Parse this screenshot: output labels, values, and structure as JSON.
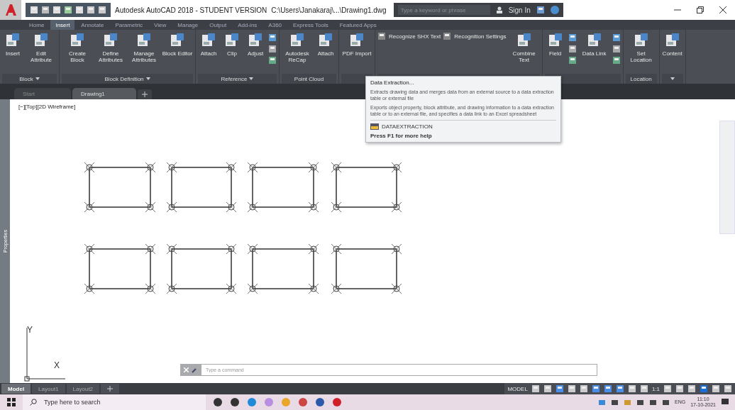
{
  "title_bar": {
    "app_title": "Autodesk AutoCAD 2018 - STUDENT VERSION",
    "file_path": "C:\\Users\\Janakaraj\\...\\Drawing1.dwg",
    "search_placeholder": "Type a keyword or phrase",
    "sign_in": "Sign In"
  },
  "ribbon_tabs": [
    {
      "label": "Home",
      "selected": false
    },
    {
      "label": "Insert",
      "selected": true
    },
    {
      "label": "Annotate",
      "selected": false
    },
    {
      "label": "Parametric",
      "selected": false
    },
    {
      "label": "View",
      "selected": false
    },
    {
      "label": "Manage",
      "selected": false
    },
    {
      "label": "Output",
      "selected": false
    },
    {
      "label": "Add-ins",
      "selected": false
    },
    {
      "label": "A360",
      "selected": false
    },
    {
      "label": "Express Tools",
      "selected": false
    },
    {
      "label": "Featured Apps",
      "selected": false
    }
  ],
  "panels": [
    {
      "title": "Block",
      "dropdown": true,
      "items": [
        {
          "kind": "large",
          "label": "Insert"
        },
        {
          "kind": "large",
          "label": "Edit Attribute"
        }
      ]
    },
    {
      "title": "Block Definition",
      "dropdown": true,
      "items": [
        {
          "kind": "large",
          "label": "Create Block"
        },
        {
          "kind": "large",
          "label": "Define Attributes"
        },
        {
          "kind": "large",
          "label": "Manage Attributes"
        },
        {
          "kind": "large",
          "label": "Block Editor"
        }
      ]
    },
    {
      "title": "Reference",
      "dropdown": true,
      "items": [
        {
          "kind": "large",
          "label": "Attach"
        },
        {
          "kind": "large",
          "label": "Clip"
        },
        {
          "kind": "large",
          "label": "Adjust"
        },
        {
          "kind": "stack"
        }
      ]
    },
    {
      "title": "Point Cloud",
      "dropdown": false,
      "items": [
        {
          "kind": "large",
          "label": "Autodesk ReCap"
        },
        {
          "kind": "large",
          "label": "Attach"
        }
      ]
    },
    {
      "items": [
        {
          "kind": "large",
          "label": "PDF Import"
        }
      ]
    },
    {
      "items": [
        {
          "kind": "small",
          "label": "Recognize SHX Text"
        },
        {
          "kind": "small",
          "label": "Recognition Settings"
        },
        {
          "kind": "large",
          "label": "Combine Text"
        }
      ]
    },
    {
      "items": [
        {
          "kind": "large",
          "label": "Field"
        },
        {
          "kind": "stack"
        },
        {
          "kind": "large",
          "label": "Data Link"
        },
        {
          "kind": "stack"
        }
      ]
    },
    {
      "title": "Location",
      "dropdown": false,
      "items": [
        {
          "kind": "large",
          "label": "Set Location"
        }
      ]
    },
    {
      "dropdown": true,
      "items": [
        {
          "kind": "large",
          "label": "Content"
        }
      ]
    }
  ],
  "doc_tabs": [
    {
      "label": "Start",
      "selected": false
    },
    {
      "label": "Drawing1",
      "selected": true
    }
  ],
  "viewport_label": "[−][Top][2D Wireframe]",
  "palette_label": "Properties",
  "ucs": {
    "x": "X",
    "y": "Y"
  },
  "command_line": {
    "placeholder": "Type a command"
  },
  "tooltip": {
    "title": "Data Extraction...",
    "description": "Extracts drawing data and merges data from an external source to a data extraction table or external file",
    "details": "Exports object property, block attribute, and drawing information to a data extraction table or to an external file, and specifies a data link to an Excel spreadsheet",
    "command": "DATAEXTRACTION",
    "help": "Press F1 for more help"
  },
  "layout_tabs": [
    {
      "label": "Model",
      "selected": true
    },
    {
      "label": "Layout1",
      "selected": false
    },
    {
      "label": "Layout2",
      "selected": false
    }
  ],
  "status_bar": {
    "mode": "MODEL",
    "scale": "1:1"
  },
  "taskbar": {
    "search_placeholder": "Type here to search",
    "language": "ENG",
    "time": "11:10",
    "date": "17-10-2021"
  }
}
